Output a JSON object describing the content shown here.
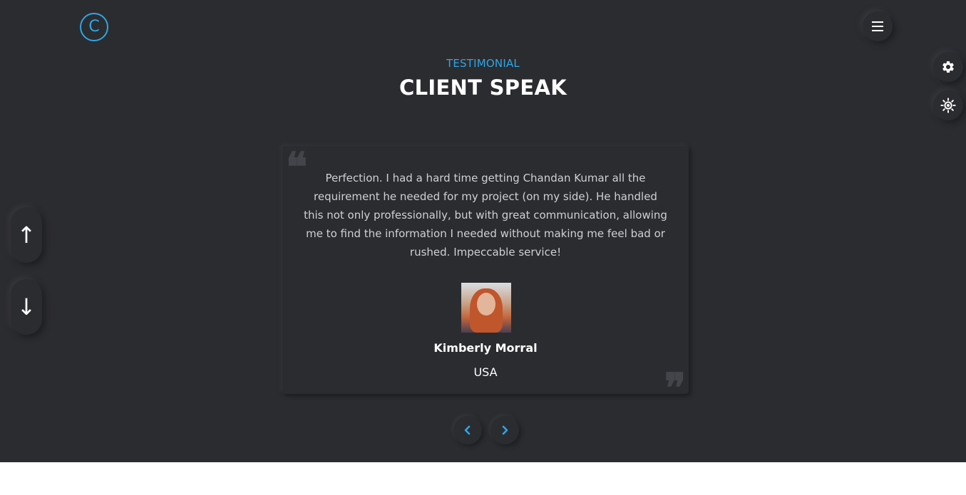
{
  "brand": {
    "logo_letter": "C",
    "accent_color": "#2ea6e6"
  },
  "header": {
    "menu_icon": "hamburger-menu-icon"
  },
  "side_controls": {
    "settings_icon": "gear-icon",
    "theme_icon": "sun-icon"
  },
  "section": {
    "subtitle": "TESTIMONIAL",
    "title": "CLIENT SPEAK"
  },
  "page_nav": {
    "up_arrow": "↑",
    "down_arrow": "↓"
  },
  "testimonial": {
    "quote_open": "❝",
    "quote_close": "❞",
    "text": "Perfection. I had a hard time getting Chandan Kumar all the requirement he needed for my project (on my side). He handled this not only professionally, but with great communication, allowing me to find the information I needed without making me feel bad or rushed. Impeccable service!",
    "author_name": "Kimberly Morral",
    "author_country": "USA"
  },
  "slider": {
    "prev_icon": "chevron-left-icon",
    "next_icon": "chevron-right-icon"
  }
}
